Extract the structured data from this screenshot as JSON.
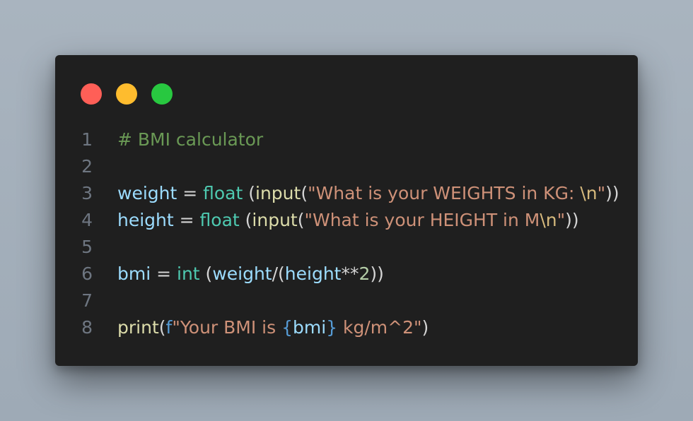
{
  "window_controls": {
    "close_color": "#ff5f57",
    "minimize_color": "#febc2e",
    "maximize_color": "#28c840"
  },
  "colors": {
    "comment": "#6a9955",
    "variable": "#9cdcfe",
    "builtin": "#4ec9b0",
    "function": "#dcdcaa",
    "string": "#ce9178",
    "escape": "#d7ba7d",
    "keyword_blue": "#569cd6",
    "number": "#b5cea8",
    "plain": "#d4d4d4",
    "line_number": "#6e7681"
  },
  "code": {
    "lines": [
      {
        "number": "1",
        "tokens": [
          {
            "text": "# BMI calculator",
            "kind": "comment"
          }
        ]
      },
      {
        "number": "2",
        "tokens": []
      },
      {
        "number": "3",
        "tokens": [
          {
            "text": "weight",
            "kind": "variable"
          },
          {
            "text": " = ",
            "kind": "plain"
          },
          {
            "text": "float",
            "kind": "builtin"
          },
          {
            "text": " (",
            "kind": "plain"
          },
          {
            "text": "input",
            "kind": "function"
          },
          {
            "text": "(",
            "kind": "plain"
          },
          {
            "text": "\"What is your WEIGHTS in KG: ",
            "kind": "string"
          },
          {
            "text": "\\n",
            "kind": "escape"
          },
          {
            "text": "\"",
            "kind": "string"
          },
          {
            "text": "))",
            "kind": "plain"
          }
        ]
      },
      {
        "number": "4",
        "tokens": [
          {
            "text": "height",
            "kind": "variable"
          },
          {
            "text": " = ",
            "kind": "plain"
          },
          {
            "text": "float",
            "kind": "builtin"
          },
          {
            "text": " (",
            "kind": "plain"
          },
          {
            "text": "input",
            "kind": "function"
          },
          {
            "text": "(",
            "kind": "plain"
          },
          {
            "text": "\"What is your HEIGHT in M",
            "kind": "string"
          },
          {
            "text": "\\n",
            "kind": "escape"
          },
          {
            "text": "\"",
            "kind": "string"
          },
          {
            "text": "))",
            "kind": "plain"
          }
        ]
      },
      {
        "number": "5",
        "tokens": []
      },
      {
        "number": "6",
        "tokens": [
          {
            "text": "bmi",
            "kind": "variable"
          },
          {
            "text": " = ",
            "kind": "plain"
          },
          {
            "text": "int",
            "kind": "builtin"
          },
          {
            "text": " (",
            "kind": "plain"
          },
          {
            "text": "weight",
            "kind": "variable"
          },
          {
            "text": "/(",
            "kind": "plain"
          },
          {
            "text": "height",
            "kind": "variable"
          },
          {
            "text": "**",
            "kind": "plain"
          },
          {
            "text": "2",
            "kind": "number"
          },
          {
            "text": "))",
            "kind": "plain"
          }
        ]
      },
      {
        "number": "7",
        "tokens": []
      },
      {
        "number": "8",
        "tokens": [
          {
            "text": "print",
            "kind": "function"
          },
          {
            "text": "(",
            "kind": "plain"
          },
          {
            "text": "f",
            "kind": "keyword_blue"
          },
          {
            "text": "\"Your BMI is ",
            "kind": "string"
          },
          {
            "text": "{",
            "kind": "keyword_blue"
          },
          {
            "text": "bmi",
            "kind": "variable"
          },
          {
            "text": "}",
            "kind": "keyword_blue"
          },
          {
            "text": " kg/m^2\"",
            "kind": "string"
          },
          {
            "text": ")",
            "kind": "plain"
          }
        ]
      }
    ]
  }
}
